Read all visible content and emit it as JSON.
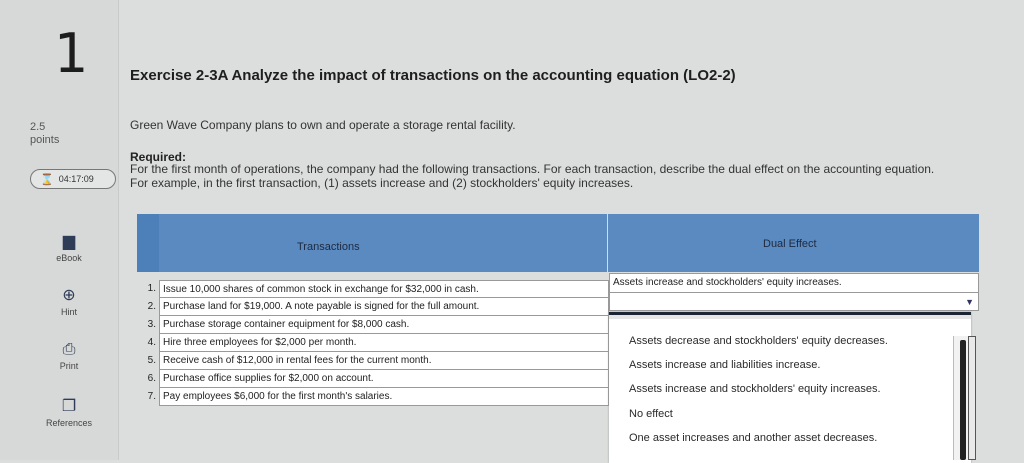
{
  "sidebar": {
    "question_number": "1",
    "points_value": "2.5",
    "points_label": "points",
    "timer": "04:17:09",
    "tools": [
      {
        "label": "eBook",
        "icon": "book-icon"
      },
      {
        "label": "Hint",
        "icon": "lifebuoy-icon"
      },
      {
        "label": "Print",
        "icon": "printer-icon"
      },
      {
        "label": "References",
        "icon": "document-icon"
      }
    ]
  },
  "exercise": {
    "title": "Exercise 2-3A Analyze the impact of transactions on the accounting equation (LO2-2)",
    "intro": "Green Wave Company plans to own and operate a storage rental facility.",
    "required_label": "Required:",
    "required_text": "For the first month of operations, the company had the following transactions. For each transaction, describe the dual effect on the accounting equation. For example, in the first transaction, (1) assets increase and (2) stockholders' equity increases."
  },
  "table": {
    "col_transactions": "Transactions",
    "col_dual_effect": "Dual Effect",
    "rows": [
      {
        "num": "1.",
        "text": "Issue 10,000 shares of common stock in exchange for $32,000 in cash."
      },
      {
        "num": "2.",
        "text": "Purchase land for $19,000. A note payable is signed for the full amount."
      },
      {
        "num": "3.",
        "text": "Purchase storage container equipment for $8,000 cash."
      },
      {
        "num": "4.",
        "text": "Hire three employees for $2,000 per month."
      },
      {
        "num": "5.",
        "text": "Receive cash of $12,000 in rental fees for the current month."
      },
      {
        "num": "6.",
        "text": "Purchase office supplies for $2,000 on account."
      },
      {
        "num": "7.",
        "text": "Pay employees $6,000 for the first month's salaries."
      }
    ],
    "answer_1": "Assets increase and stockholders' equity increases."
  },
  "dropdown": {
    "options": [
      "Assets decrease and stockholders' equity decreases.",
      "Assets increase and liabilities increase.",
      "Assets increase and stockholders' equity increases.",
      "No effect",
      "One asset increases and another asset decreases."
    ]
  }
}
